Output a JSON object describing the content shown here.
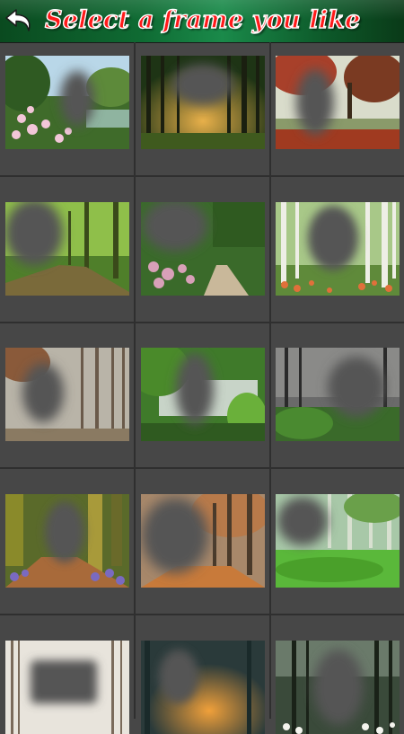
{
  "header": {
    "title": "Select a frame you like",
    "back_label": "Back"
  },
  "colors": {
    "title_fill": "#ff1a1a",
    "title_outline": "#ffffff",
    "header_green": "#0f6b33",
    "grid_background": "#474747",
    "frame_hole": "#555555"
  },
  "frames": [
    {
      "id": 1,
      "scene": "pink blossoms by a forest pond"
    },
    {
      "id": 2,
      "scene": "sunlit forest with tall trunks"
    },
    {
      "id": 3,
      "scene": "red autumn trees in a park"
    },
    {
      "id": 4,
      "scene": "green forest with a dirt path"
    },
    {
      "id": 5,
      "scene": "garden path with flowering bushes"
    },
    {
      "id": 6,
      "scene": "birch trees with orange flowers"
    },
    {
      "id": 7,
      "scene": "misty autumn forest"
    },
    {
      "id": 8,
      "scene": "green forest with a stream"
    },
    {
      "id": 9,
      "scene": "dark misty forest with ferns"
    },
    {
      "id": 10,
      "scene": "bluebell forest path"
    },
    {
      "id": 11,
      "scene": "autumn forest path with leaves"
    },
    {
      "id": 12,
      "scene": "mossy green forest floor"
    },
    {
      "id": 13,
      "scene": "snowy winter forest"
    },
    {
      "id": 14,
      "scene": "forest river at sunset"
    },
    {
      "id": 15,
      "scene": "white flowers under dark trees"
    }
  ]
}
